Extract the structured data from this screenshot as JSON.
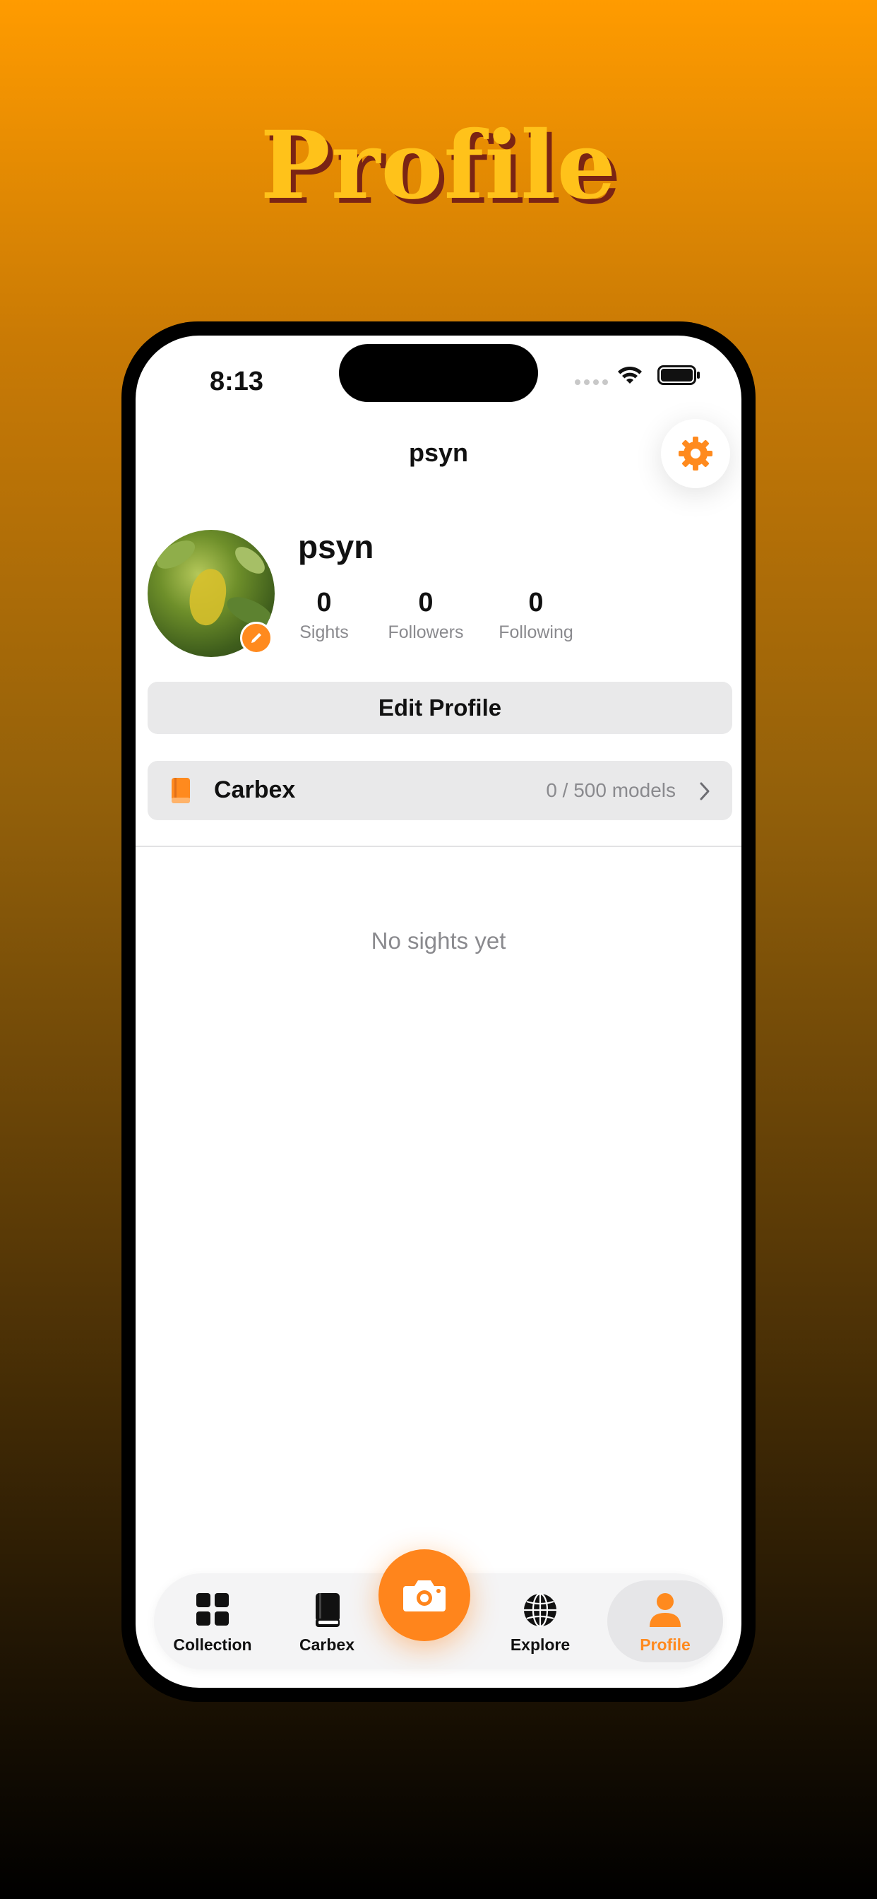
{
  "promo": {
    "title": "Profile"
  },
  "status_bar": {
    "time": "8:13"
  },
  "nav": {
    "title": "psyn"
  },
  "profile": {
    "username": "psyn",
    "stats": [
      {
        "value": "0",
        "label": "Sights"
      },
      {
        "value": "0",
        "label": "Followers"
      },
      {
        "value": "0",
        "label": "Following"
      }
    ],
    "edit_button_label": "Edit Profile"
  },
  "carbex_row": {
    "label": "Carbex",
    "count": "0 / 500 models"
  },
  "empty_state": {
    "message": "No sights yet"
  },
  "tab_bar": {
    "tabs": [
      {
        "label": "Collection",
        "icon": "grid-icon",
        "active": false
      },
      {
        "label": "Carbex",
        "icon": "book-icon",
        "active": false
      },
      {
        "label": "",
        "icon": "camera-icon",
        "active": false
      },
      {
        "label": "Explore",
        "icon": "globe-icon",
        "active": false
      },
      {
        "label": "Profile",
        "icon": "person-icon",
        "active": true
      }
    ]
  },
  "colors": {
    "accent": "#ff8a1e",
    "title_yellow": "#ffc21a",
    "title_shadow": "#7a2414",
    "muted_text": "#8a8a8e",
    "button_gray": "#e9e9ea"
  }
}
